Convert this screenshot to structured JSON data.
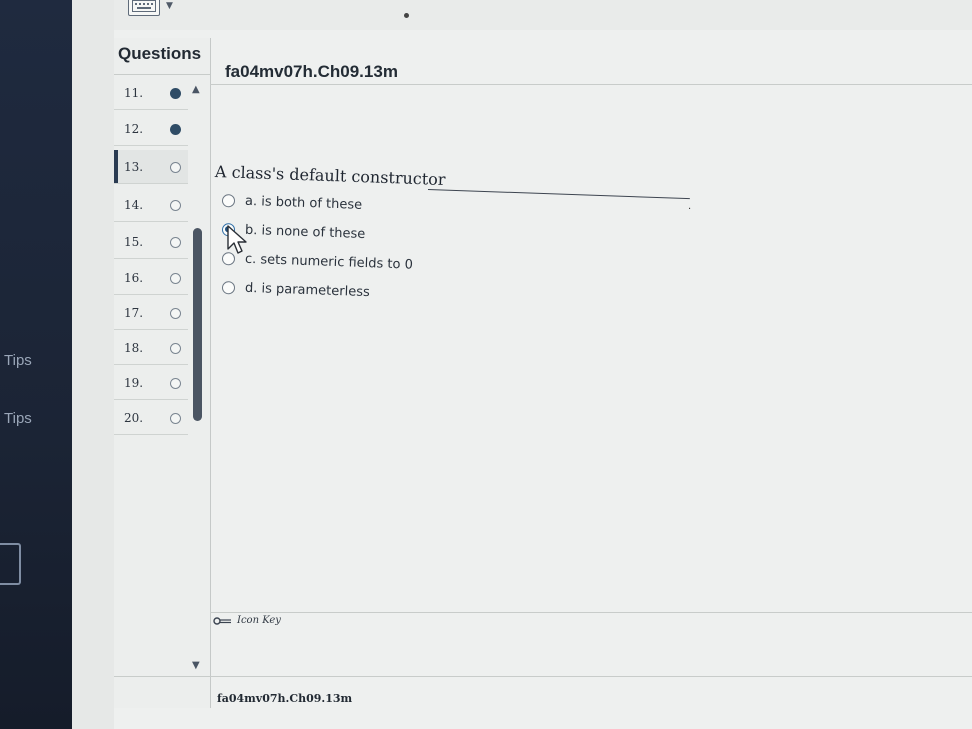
{
  "sidebar": {
    "tips": [
      "Tips",
      "Tips"
    ]
  },
  "questions_panel": {
    "header": "Questions",
    "items": [
      {
        "number": "11.",
        "status": "answered"
      },
      {
        "number": "12.",
        "status": "answered"
      },
      {
        "number": "13.",
        "status": "unanswered",
        "current": true
      },
      {
        "number": "14.",
        "status": "unanswered"
      },
      {
        "number": "15.",
        "status": "unanswered"
      },
      {
        "number": "16.",
        "status": "unanswered"
      },
      {
        "number": "17.",
        "status": "unanswered"
      },
      {
        "number": "18.",
        "status": "unanswered"
      },
      {
        "number": "19.",
        "status": "unanswered"
      },
      {
        "number": "20.",
        "status": "unanswered"
      }
    ]
  },
  "main": {
    "question_id": "fa04mv07h.Ch09.13m",
    "question_text": "A class's default constructor",
    "blank_terminator": ".",
    "options": [
      {
        "label": "a. is both of these",
        "selected": false
      },
      {
        "label": "b. is none of these",
        "selected": true
      },
      {
        "label": "c. sets numeric fields to 0",
        "selected": false
      },
      {
        "label": "d. is parameterless",
        "selected": false
      }
    ]
  },
  "icon_key": {
    "label": "Icon Key",
    "icon": "key-icon"
  },
  "footer": {
    "question_ref": "fa04mv07h.Ch09.13m"
  },
  "colors": {
    "answered": "#2f4c66",
    "left_rail": "#1f2a3f",
    "selected_radio": "#1f4e7a"
  }
}
